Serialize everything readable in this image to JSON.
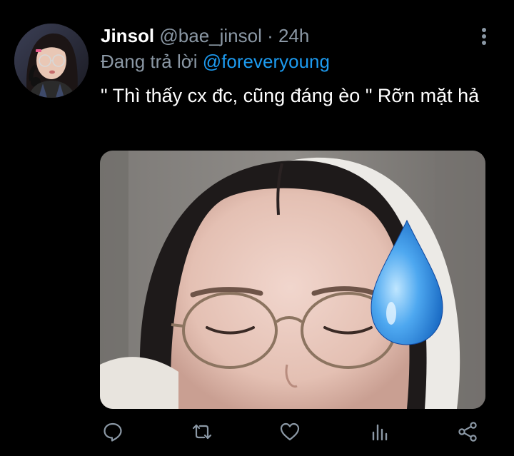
{
  "tweet": {
    "display_name": "Jinsol",
    "handle": "@bae_jinsol",
    "separator": "·",
    "time": "24h",
    "reply_prefix": "Đang trả lời",
    "reply_to": "@foreveryoung",
    "text": "\" Thì thấy cx đc, cũng đáng èo \" Rỡn mặt hả"
  },
  "icons": {
    "more": "more-vertical-icon",
    "reply": "reply-icon",
    "retweet": "retweet-icon",
    "like": "heart-icon",
    "analytics": "analytics-icon",
    "share": "share-icon",
    "sweat_drop": "sweat-droplet-emoji"
  },
  "colors": {
    "background": "#000000",
    "secondary_text": "#8b98a5",
    "accent": "#1d9bf0",
    "icon": "#8b98a5"
  }
}
